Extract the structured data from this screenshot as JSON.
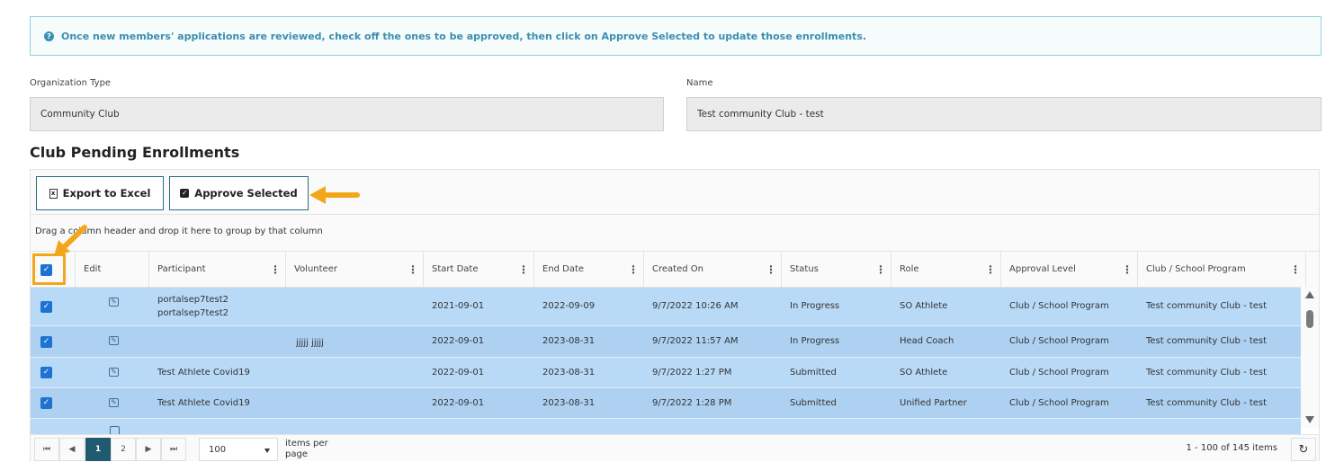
{
  "info_banner": {
    "text": "Once new members' applications are reviewed, check off the ones to be approved, then click on Approve Selected to update those enrollments.",
    "icon": "question-circle-icon"
  },
  "org_type": {
    "label": "Organization Type",
    "value": "Community Club"
  },
  "name": {
    "label": "Name",
    "value": "Test community Club - test"
  },
  "section_title": "Club Pending Enrollments",
  "toolbar": {
    "export_label": "Export to Excel",
    "approve_label": "Approve Selected"
  },
  "group_hint": "Drag a column header and drop it here to group by that column",
  "columns": [
    "Edit",
    "Participant",
    "Volunteer",
    "Start Date",
    "End Date",
    "Created On",
    "Status",
    "Role",
    "Approval Level",
    "Club / School Program"
  ],
  "rows": [
    {
      "participant": "portalsep7test2 portalsep7test2",
      "volunteer": "",
      "start": "2021-09-01",
      "end": "2022-09-09",
      "created": "9/7/2022 10:26 AM",
      "status": "In Progress",
      "role": "SO Athlete",
      "approval": "Club / School Program",
      "club": "Test community Club - test"
    },
    {
      "participant": "",
      "volunteer": "jjjjj jjjjj",
      "start": "2022-09-01",
      "end": "2023-08-31",
      "created": "9/7/2022 11:57 AM",
      "status": "In Progress",
      "role": "Head Coach",
      "approval": "Club / School Program",
      "club": "Test community Club - test"
    },
    {
      "participant": "Test Athlete Covid19",
      "volunteer": "",
      "start": "2022-09-01",
      "end": "2023-08-31",
      "created": "9/7/2022 1:27 PM",
      "status": "Submitted",
      "role": "SO Athlete",
      "approval": "Club / School Program",
      "club": "Test community Club - test"
    },
    {
      "participant": "Test Athlete Covid19",
      "volunteer": "",
      "start": "2022-09-01",
      "end": "2023-08-31",
      "created": "9/7/2022 1:28 PM",
      "status": "Submitted",
      "role": "Unified Partner",
      "approval": "Club / School Program",
      "club": "Test community Club - test"
    }
  ],
  "pager": {
    "pages": [
      "1",
      "2"
    ],
    "current": "1",
    "page_size": "100",
    "items_per_page": "items per page",
    "info": "1 - 100 of 145 items"
  },
  "colors": {
    "accent": "#f2a71b",
    "selected_row": "#b9daf7",
    "checkbox": "#1d73d2",
    "banner_text": "#3a8fb0"
  }
}
